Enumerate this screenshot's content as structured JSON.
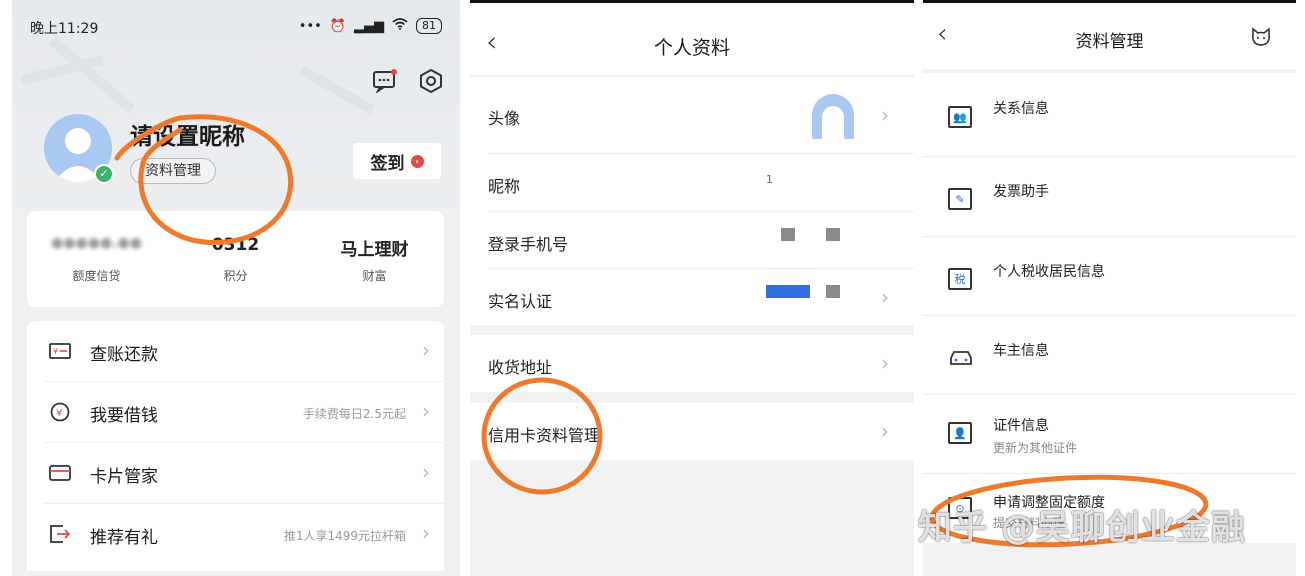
{
  "panel1": {
    "status": {
      "time": "晚上11:29",
      "battery": "81",
      "icons": [
        "more-dots-icon",
        "alarm-icon",
        "hd-signal-icon",
        "wifi-icon",
        "battery-icon"
      ]
    },
    "header": {
      "nickname": "请设置昵称",
      "profile_tag": "资料管理",
      "signin_label": "签到"
    },
    "stats": [
      {
        "value": "●●●●●.●●",
        "label": "额度信贷"
      },
      {
        "value": "0312",
        "label": "积分"
      },
      {
        "value": "马上理财",
        "label": "财富"
      }
    ],
    "menu": [
      {
        "label": "查账还款",
        "note": "",
        "icon": "bill-icon"
      },
      {
        "label": "我要借钱",
        "note": "手续费每日2.5元起",
        "icon": "loan-icon"
      },
      {
        "label": "卡片管家",
        "note": "",
        "icon": "card-icon"
      },
      {
        "label": "推荐有礼",
        "note": "推1人享1499元拉杆箱",
        "icon": "share-icon"
      }
    ]
  },
  "panel2": {
    "title": "个人资料",
    "rows": [
      {
        "label": "头像"
      },
      {
        "label": "昵称",
        "value": "1"
      },
      {
        "label": "登录手机号"
      },
      {
        "label": "实名认证"
      }
    ],
    "address_label": "收货地址",
    "card_label": "信用卡资料管理"
  },
  "panel3": {
    "title": "资料管理",
    "rows": [
      {
        "title": "关系信息",
        "sub": "",
        "icon": "relation-icon"
      },
      {
        "title": "发票助手",
        "sub": "",
        "icon": "invoice-icon"
      },
      {
        "title": "个人税收居民信息",
        "sub": "",
        "icon": "tax-icon",
        "glyph": "税"
      },
      {
        "title": "车主信息",
        "sub": "",
        "icon": "car-icon"
      },
      {
        "title": "证件信息",
        "sub": "更新为其他证件",
        "icon": "id-card-icon"
      },
      {
        "title": "申请调整固定额度",
        "sub": "提交材料办理",
        "icon": "credit-limit-icon"
      }
    ]
  },
  "watermark": "知乎 @吴聊创业金融",
  "colors": {
    "scribble": "#f07a2c",
    "brand_red": "#e84545",
    "accent_blue": "#2f6ee0"
  }
}
